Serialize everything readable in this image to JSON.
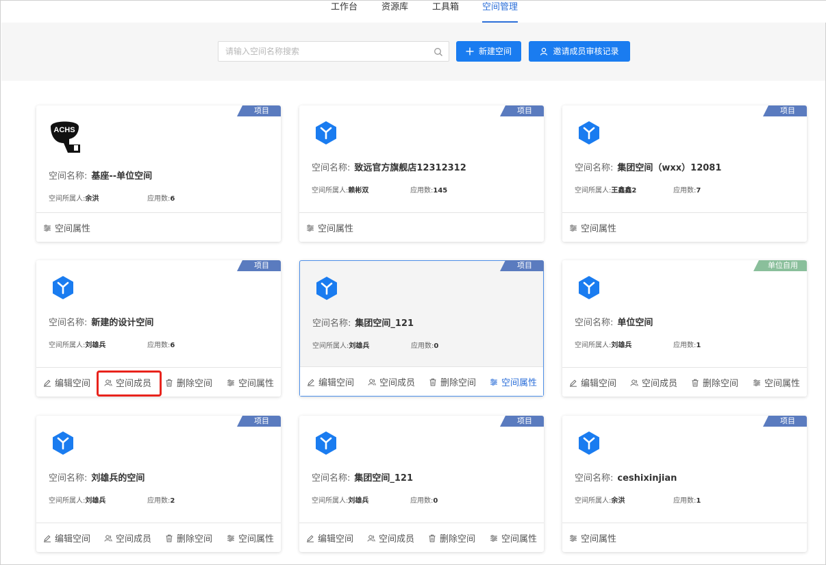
{
  "nav": {
    "items": [
      {
        "label": "工作台"
      },
      {
        "label": "资源库"
      },
      {
        "label": "工具箱"
      },
      {
        "label": "空间管理"
      }
    ]
  },
  "search": {
    "placeholder": "请输入空间名称搜索"
  },
  "buttons": {
    "new_space": "新建空间",
    "invite_records": "邀请成员审核记录"
  },
  "labels": {
    "space_name": "空间名称:",
    "owner": "空间所属人:",
    "apps": "应用数:"
  },
  "actions": {
    "edit": "编辑空间",
    "members": "空间成员",
    "delete": "删除空间",
    "props": "空间属性"
  },
  "cards": [
    {
      "tag": "项目",
      "name": "基座--单位空间",
      "owner": "余洪",
      "apps": "6",
      "logo_text": "ACHS"
    },
    {
      "tag": "项目",
      "name": "致远官方旗舰店12312312",
      "owner": "赖彬双",
      "apps": "145"
    },
    {
      "tag": "项目",
      "name": "集团空间（wxx）12081",
      "owner": "王鑫鑫2",
      "apps": "7"
    },
    {
      "tag": "项目",
      "name": "新建的设计空间",
      "owner": "刘雄兵",
      "apps": "6"
    },
    {
      "tag": "项目",
      "name": "集团空间_121",
      "owner": "刘雄兵",
      "apps": "0"
    },
    {
      "tag": "单位自用",
      "name": "单位空间",
      "owner": "刘雄兵",
      "apps": "1"
    },
    {
      "tag": "项目",
      "name": "刘雄兵的空间",
      "owner": "刘雄兵",
      "apps": "2"
    },
    {
      "tag": "项目",
      "name": "集团空间_121",
      "owner": "刘雄兵",
      "apps": "0"
    },
    {
      "tag": "项目",
      "name": "ceshixinjian",
      "owner": "余洪",
      "apps": "1"
    }
  ],
  "colors": {
    "accent": "#1a7cf0",
    "tag_project": "#5a7bbf",
    "tag_unit": "#8abf9b",
    "highlight": "#e8231c"
  }
}
